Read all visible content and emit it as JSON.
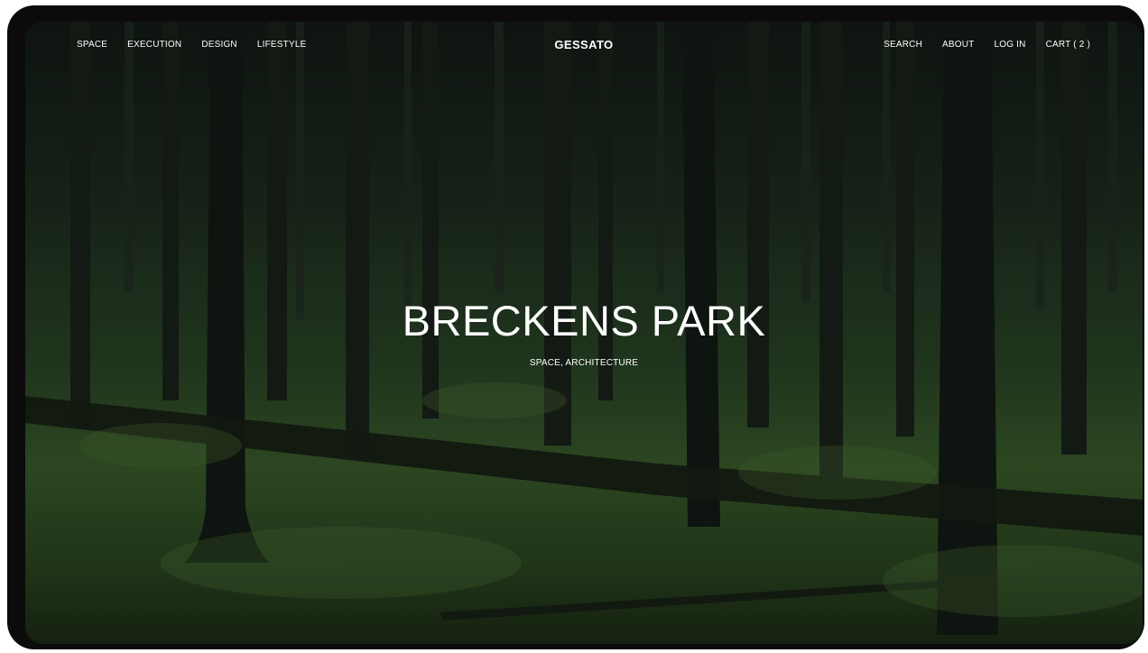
{
  "nav": {
    "left_items": [
      "SPACE",
      "EXECUTION",
      "DESIGN",
      "LIFESTYLE"
    ],
    "logo": "GESSATO",
    "right_items": [
      "SEARCH",
      "ABOUT",
      "LOG IN",
      "CART ( 2 )"
    ]
  },
  "hero": {
    "title": "BRECKENS PARK",
    "subtitle": "SPACE, ARCHITECTURE",
    "background": "dark-forest-photo"
  },
  "colors": {
    "text": "#ffffff",
    "frame": "#0b0b0b",
    "forest_dark": "#162019",
    "moss": "#2e4a22"
  }
}
